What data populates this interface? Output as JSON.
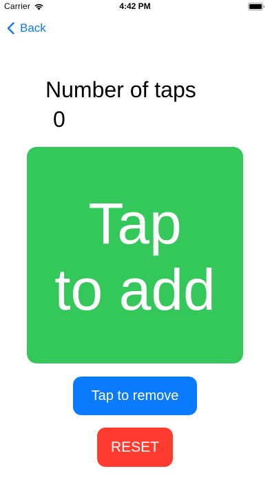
{
  "status_bar": {
    "carrier": "Carrier",
    "time": "4:42 PM",
    "wifi_icon": "wifi-icon",
    "battery_icon": "battery-icon"
  },
  "nav": {
    "back_label": "Back",
    "back_icon": "chevron-left-icon",
    "accent_color": "#0a7aff"
  },
  "counter": {
    "title": "Number of taps",
    "value": "0"
  },
  "buttons": {
    "add_label_line1": "Tap",
    "add_label_line2": "to add",
    "add_color": "#34c759",
    "remove_label": "Tap to remove",
    "remove_color": "#0a7aff",
    "reset_label": "RESET",
    "reset_color": "#ff3b30"
  }
}
